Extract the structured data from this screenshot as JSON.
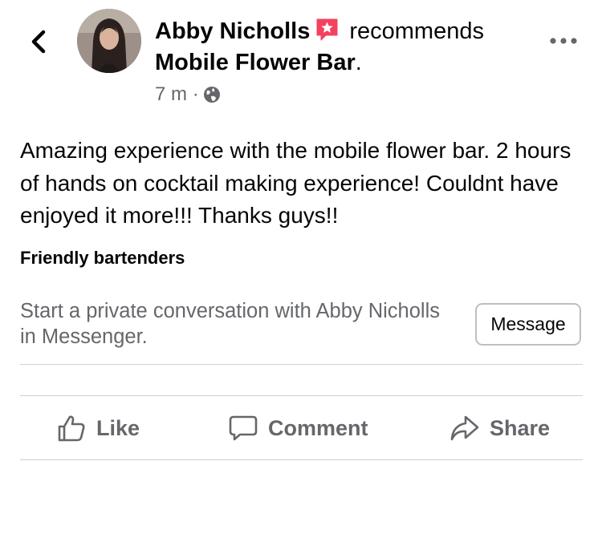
{
  "header": {
    "author": "Abby Nicholls",
    "action_text": "recommends",
    "page_name": "Mobile Flower Bar",
    "page_name_suffix": ".",
    "time": "7 m",
    "meta_separator": "·",
    "audience_icon": "globe-icon",
    "badge_icon": "recommend-star-icon",
    "badge_color": "#f3425f",
    "more_icon": "more-horizontal-icon",
    "back_icon": "chevron-left-icon"
  },
  "post": {
    "text": "Amazing experience with the mobile flower bar. 2 hours of hands on cocktail making experience! Couldnt have enjoyed it more!!! Thanks guys!!",
    "tag": "Friendly bartenders"
  },
  "private_message": {
    "text": "Start a private conversation with Abby Nicholls in Messenger.",
    "button_label": "Message"
  },
  "actions": [
    {
      "label": "Like",
      "icon": "thumbs-up-icon"
    },
    {
      "label": "Comment",
      "icon": "comment-icon"
    },
    {
      "label": "Share",
      "icon": "share-icon"
    }
  ]
}
